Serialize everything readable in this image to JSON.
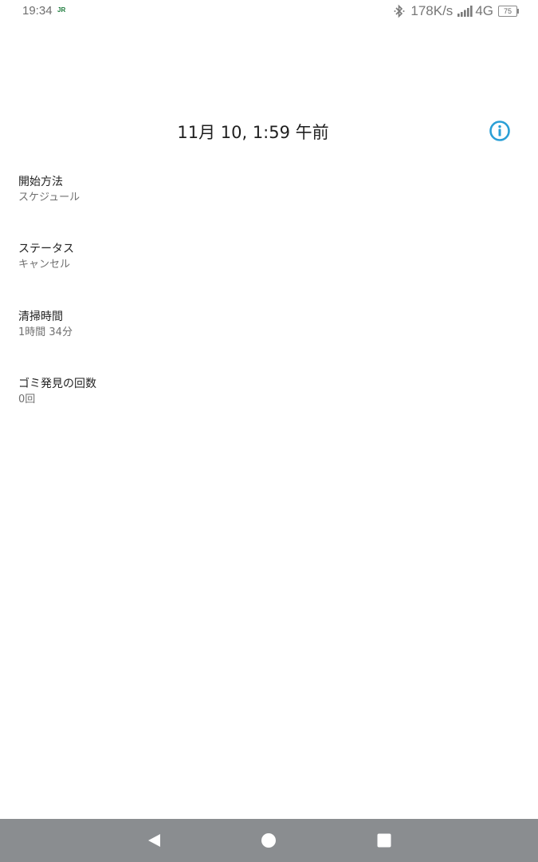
{
  "status_bar": {
    "time": "19:34",
    "carrier_badge": "JR",
    "net_speed": "178K/s",
    "network_type": "4G",
    "battery_level": "75"
  },
  "header": {
    "title": "11月 10, 1:59 午前",
    "info_icon": "info-icon",
    "accent_color": "#2a9fd6"
  },
  "details": [
    {
      "label": "開始方法",
      "value": "スケジュール"
    },
    {
      "label": "ステータス",
      "value": "キャンセル"
    },
    {
      "label": "清掃時間",
      "value": "1時間 34分"
    },
    {
      "label": "ゴミ発見の回数",
      "value": "0回"
    }
  ],
  "nav_bar": {
    "back_icon": "back-triangle-icon",
    "home_icon": "home-circle-icon",
    "recent_icon": "recent-apps-square-icon",
    "background_color": "#8a8d90"
  }
}
